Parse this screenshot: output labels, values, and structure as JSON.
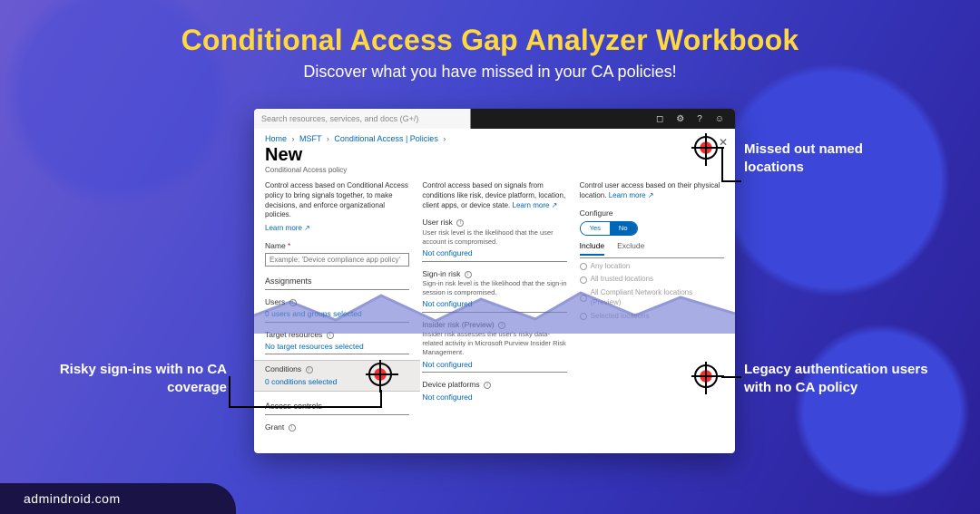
{
  "hero": {
    "title": "Conditional Access Gap Analyzer Workbook",
    "subtitle": "Discover what you have missed in your CA policies!"
  },
  "topbar": {
    "search_placeholder": "Search resources, services, and docs (G+/)"
  },
  "breadcrumbs": {
    "items": [
      "Home",
      "MSFT",
      "Conditional Access | Policies"
    ]
  },
  "page": {
    "title": "New",
    "subtitle": "Conditional Access policy"
  },
  "col1": {
    "desc": "Control access based on Conditional Access policy to bring signals together, to make decisions, and enforce organizational policies.",
    "learn": "Learn more",
    "name_label": "Name",
    "name_placeholder": "Example: 'Device compliance app policy'",
    "assignments": "Assignments",
    "users_label": "Users",
    "users_value": "0 users and groups selected",
    "target_label": "Target resources",
    "target_value": "No target resources selected",
    "conditions_label": "Conditions",
    "conditions_value": "0 conditions selected",
    "access_controls": "Access controls",
    "grant_label": "Grant"
  },
  "col2": {
    "desc": "Control access based on signals from conditions like risk, device platform, location, client apps, or device state.",
    "learn": "Learn more",
    "user_risk_label": "User risk",
    "user_risk_desc": "User risk level is the likelihood that the user account is compromised.",
    "not_configured": "Not configured",
    "signin_label": "Sign-in risk",
    "signin_desc": "Sign-in risk level is the likelihood that the sign-in session is compromised.",
    "insider_label": "Insider risk (Preview)",
    "insider_desc": "Insider risk assesses the user's risky data-related activity in Microsoft Purview Insider Risk Management.",
    "device_label": "Device platforms"
  },
  "col3": {
    "desc": "Control user access based on their physical location.",
    "learn": "Learn more",
    "configure_label": "Configure",
    "toggle_yes": "Yes",
    "toggle_no": "No",
    "include": "Include",
    "exclude": "Exclude",
    "opt_any": "Any location",
    "opt_trusted": "All trusted locations",
    "opt_compliant": "All Compliant Network locations (Preview)",
    "opt_selected": "Selected locations"
  },
  "callouts": {
    "named_locations": "Missed out named locations",
    "legacy_auth": "Legacy authentication users with no CA policy",
    "risky_signins": "Risky sign-ins with no CA coverage"
  },
  "footer": {
    "brand": "admindroid.com"
  }
}
